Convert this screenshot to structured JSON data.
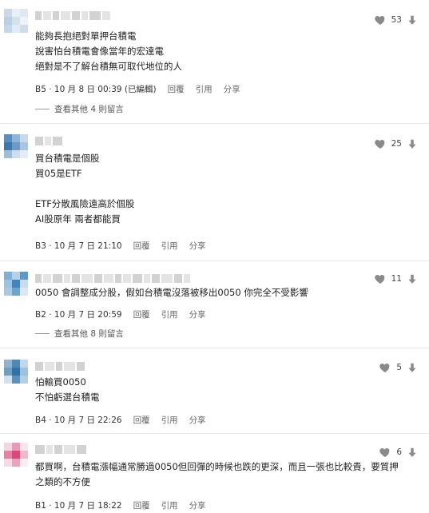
{
  "comments": [
    {
      "lines": [
        "能夠長抱絕對單押台積電",
        "說害怕台積電會像當年的宏達電",
        "絕對是不了解台積無可取代地位的人"
      ],
      "floor": "B5",
      "time": "10 月 8 日 00:39 (已編輯)",
      "reply_label": "回覆",
      "quote_label": "引用",
      "share_label": "分享",
      "more_replies": "查看其他 4 則留言",
      "likes": "53",
      "avatar_colors": [
        "#c9d9ea",
        "#e9eff6",
        "#dfe7f0",
        "#b9cfe3",
        "#d4e0ec",
        "#eef3f8",
        "#c4d6e8",
        "#e2ebf3",
        "#d0dcea"
      ]
    },
    {
      "lines": [
        "買台積電是個股",
        "買05是ETF",
        "",
        "ETF分散風險遠高於個股",
        "AI股原年 兩者都能買"
      ],
      "floor": "B3",
      "time": "10 月 7 日 21:10",
      "reply_label": "回覆",
      "quote_label": "引用",
      "share_label": "分享",
      "likes": "25",
      "avatar_colors": [
        "#5a8fbf",
        "#8fb4d6",
        "#c7d9ea",
        "#3f78ab",
        "#6d9bc5",
        "#a9c5df",
        "#9dbdd9",
        "#cfdeed",
        "#e4edf5"
      ]
    },
    {
      "lines": [
        "0050 會調整成分股，假如台積電沒落被移出0050 你完全不受影響"
      ],
      "floor": "B2",
      "time": "10 月 7 日 20:59",
      "reply_label": "回覆",
      "quote_label": "引用",
      "share_label": "分享",
      "more_replies": "查看其他 8 則留言",
      "likes": "11",
      "avatar_colors": [
        "#7fb0d6",
        "#b5d1e8",
        "#5e98c6",
        "#9cc2e1",
        "#3f86bf",
        "#c8dcee",
        "#a7c8e3",
        "#6ea5cf",
        "#dbe8f3"
      ]
    },
    {
      "lines": [
        "怕輸買0050",
        "不怕虧選台積電"
      ],
      "floor": "B4",
      "time": "10 月 7 日 22:26",
      "reply_label": "回覆",
      "quote_label": "引用",
      "share_label": "分享",
      "likes": "5",
      "avatar_colors": [
        "#8fb3d1",
        "#4f88b5",
        "#c3d7e8",
        "#6e9ec4",
        "#2f72a6",
        "#a0c1dc",
        "#d2e1ee",
        "#5d91bb",
        "#b7cfe3"
      ]
    },
    {
      "lines": [
        "都買啊，台積電漲幅通常勝過0050但回彈的時候也跌的更深，而且一張也比較貴，要質押",
        "之類的不方便"
      ],
      "floor": "B1",
      "time": "10 月 7 日 18:22",
      "reply_label": "回覆",
      "quote_label": "引用",
      "share_label": "分享",
      "likes": "6",
      "avatar_colors": [
        "#f3d6e1",
        "#e79ab7",
        "#f8e6ee",
        "#e6829f",
        "#d9487d",
        "#efb9cc",
        "#f6dbe5",
        "#eaa3bd",
        "#fbeef3"
      ]
    }
  ],
  "colors": {
    "icon": "#8a8a8a",
    "name_blur": "#d8d8d8"
  }
}
